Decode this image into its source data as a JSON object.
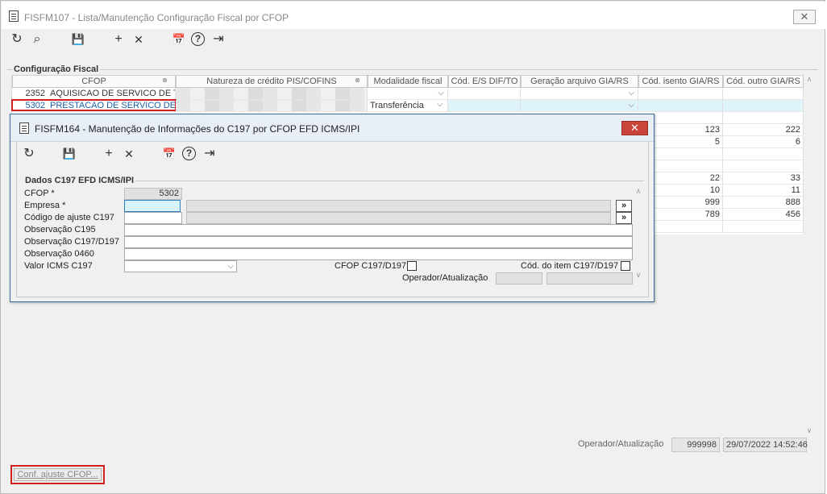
{
  "main_window": {
    "title": "FISFM107 - Lista/Manutenção Configuração Fiscal por CFOP",
    "close_label": "✕",
    "toolbar": {
      "refresh": "↻",
      "search": "⌕",
      "save": "💾",
      "add": "+",
      "delete": "✕",
      "calendar": "📅",
      "help": "?",
      "exit": "⇥"
    },
    "group_label": "Configuração Fiscal",
    "columns": [
      "CFOP",
      "Natureza de crédito PIS/COFINS",
      "Modalidade fiscal",
      "Cód. E/S DIF/TO",
      "Geração arquivo GIA/RS",
      "Cód. isento GIA/RS",
      "Cód. outro GIA/RS"
    ],
    "rows": [
      {
        "cfop_code": "2352",
        "cfop_desc": "AQUISICAO DE SERVICO DE TRA",
        "modalidade": "",
        "isento": "",
        "outro": ""
      },
      {
        "cfop_code": "5302",
        "cfop_desc": "PRESTACAO DE SERVICO DE CO",
        "modalidade": "Transferência",
        "isento": "",
        "outro": ""
      },
      {
        "cfop_code": "",
        "cfop_desc": "",
        "modalidade": "",
        "isento": "",
        "outro": ""
      },
      {
        "cfop_code": "",
        "cfop_desc": "",
        "modalidade": "",
        "isento": "123",
        "outro": "222"
      },
      {
        "cfop_code": "",
        "cfop_desc": "",
        "modalidade": "",
        "isento": "5",
        "outro": "6"
      },
      {
        "cfop_code": "",
        "cfop_desc": "",
        "modalidade": "",
        "isento": "",
        "outro": ""
      },
      {
        "cfop_code": "",
        "cfop_desc": "",
        "modalidade": "",
        "isento": "",
        "outro": ""
      },
      {
        "cfop_code": "",
        "cfop_desc": "",
        "modalidade": "",
        "isento": "22",
        "outro": "33"
      },
      {
        "cfop_code": "",
        "cfop_desc": "",
        "modalidade": "",
        "isento": "10",
        "outro": "11"
      },
      {
        "cfop_code": "",
        "cfop_desc": "",
        "modalidade": "",
        "isento": "999",
        "outro": "888"
      },
      {
        "cfop_code": "",
        "cfop_desc": "",
        "modalidade": "",
        "isento": "789",
        "outro": "456"
      }
    ],
    "footer": {
      "operador_label": "Operador/Atualização",
      "operador_value": "999998",
      "timestamp": "29/07/2022 14:52:46"
    },
    "conf_button": "Conf. ajuste CFOP..."
  },
  "dialog": {
    "title": "FISFM164 - Manutenção de Informações do C197 por CFOP EFD ICMS/IPI",
    "close_label": "✕",
    "group_label": "Dados C197 EFD ICMS/IPI",
    "fields": {
      "cfop_label": "CFOP *",
      "cfop_value": "5302",
      "empresa_label": "Empresa *",
      "codigo_ajuste_label": "Código de ajuste C197",
      "obs_c195_label": "Observação C195",
      "obs_c197_label": "Observação C197/D197",
      "obs_0460_label": "Observação 0460",
      "valor_icms_label": "Valor ICMS C197",
      "cfop_c197_label": "CFOP C197/D197",
      "cod_item_label": "Cód. do item C197/D197",
      "operador_label": "Operador/Atualização",
      "lookup_label": "»"
    }
  },
  "colors": {
    "selection_border": "#d02020",
    "dialog_close": "#c9453a",
    "selected_row": "#dff3fb"
  }
}
